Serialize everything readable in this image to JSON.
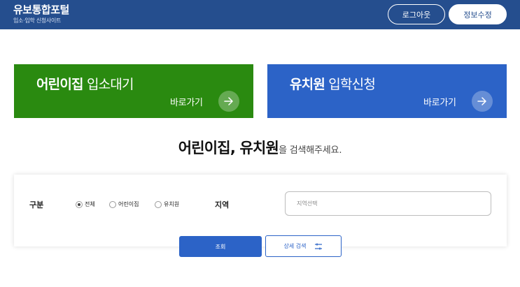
{
  "header": {
    "title": "유보통합포털",
    "subtitle": "입소·입학 신청사이트",
    "logout_label": "로그아웃",
    "profile_label": "정보수정"
  },
  "cards": {
    "daycare": {
      "title_bold": "어린이집",
      "title_rest": " 입소대기",
      "go_label": "바로가기",
      "color": "#2a8a10"
    },
    "kindergarten": {
      "title_bold": "유치원",
      "title_rest": " 입학신청",
      "go_label": "바로가기",
      "color": "#2c63c7"
    }
  },
  "headline": {
    "strong": "어린이집, 유치원",
    "rest": "을 검색해주세요."
  },
  "search": {
    "type_label": "구분",
    "options": [
      {
        "label": "전체",
        "selected": true
      },
      {
        "label": "어린이집",
        "selected": false
      },
      {
        "label": "유치원",
        "selected": false
      }
    ],
    "region_label": "지역",
    "region_placeholder": "지역선택",
    "submit_label": "조회",
    "detail_label": "상세 검색"
  },
  "icons": {
    "card_arrow": "arrow-right-icon",
    "detail": "filter-sliders-icon"
  },
  "colors": {
    "header_bg": "#254e8e",
    "primary_blue": "#2c63c7",
    "daycare_green": "#2a8a10"
  }
}
